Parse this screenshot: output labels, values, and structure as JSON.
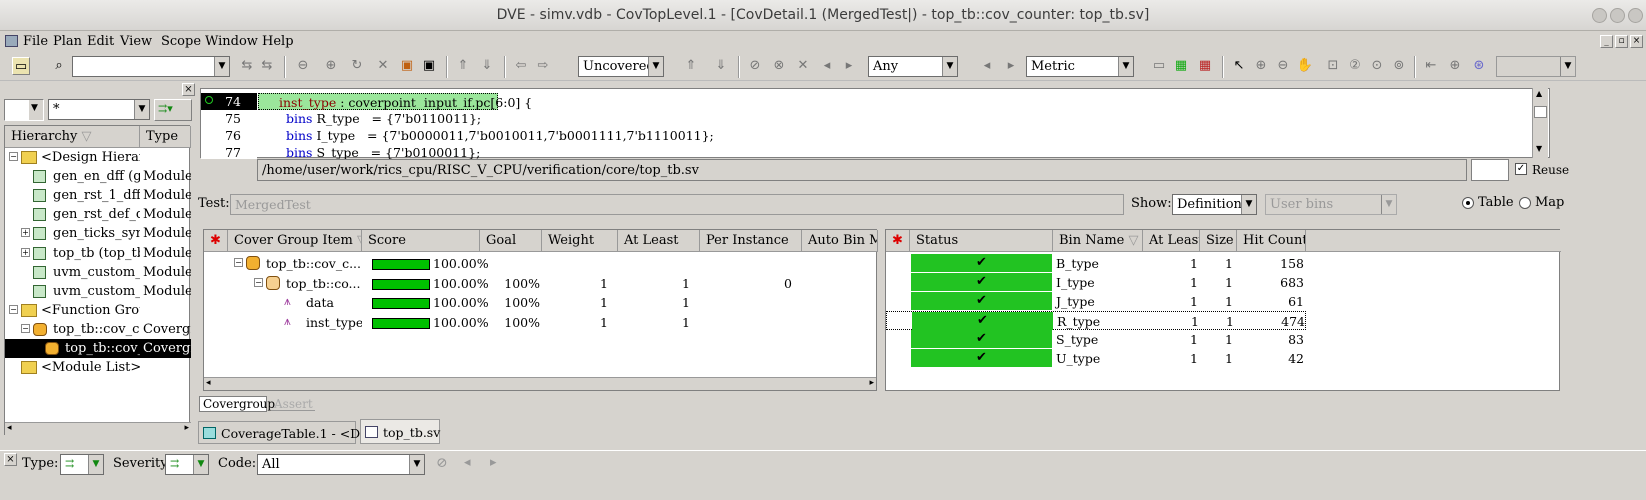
{
  "window": {
    "title": "DVE - simv.vdb - CovTopLevel.1 - [CovDetail.1 (MergedTest|) - top_tb::cov_counter: top_tb.sv]"
  },
  "menubar": {
    "items": [
      "File",
      "Plan",
      "Edit",
      "View",
      "Scope",
      "Window",
      "Help"
    ]
  },
  "toolbar": {
    "search_value": "",
    "filter_value": "Uncovered",
    "any_value": "Any",
    "metric_value": "Metric",
    "last_value": ""
  },
  "hierarchy": {
    "filter_value": "*",
    "col_hierarchy": "Hierarchy",
    "col_type": "Type",
    "rows": [
      {
        "label": "<Design Hierar...",
        "type": ""
      },
      {
        "label": "gen_en_dff (ge...",
        "type": "Module"
      },
      {
        "label": "gen_rst_1_dff ...",
        "type": "Module"
      },
      {
        "label": "gen_rst_def_df...",
        "type": "Module"
      },
      {
        "label": "gen_ticks_sync...",
        "type": "Module"
      },
      {
        "label": "top_tb (top_tb)",
        "type": "Module"
      },
      {
        "label": "uvm_custom_i...",
        "type": "Module"
      },
      {
        "label": "uvm_custom_i...",
        "type": "Module"
      },
      {
        "label": "<Function Grou...",
        "type": ""
      },
      {
        "label": "top_tb::cov_c...",
        "type": "Covergro"
      },
      {
        "label": "top_tb::cov_...",
        "type": "Covergro"
      },
      {
        "label": "<Module List>",
        "type": ""
      }
    ]
  },
  "source": {
    "lines": [
      {
        "num": "74",
        "kw": "inst_type",
        "rest": " : coverpoint  input_if.pc[6:0] {"
      },
      {
        "num": "75",
        "kw": "bins",
        "rest": " R_type   = {7'b0110011};"
      },
      {
        "num": "76",
        "kw": "bins",
        "rest": " I_type   = {7'b0000011,7'b0010011,7'b0001111,7'b1110011};"
      },
      {
        "num": "77",
        "kw": "bins",
        "rest": " S_type   = {7'b0100011};"
      }
    ],
    "path": "/home/user/work/rics_cpu/RISC_V_CPU/verification/core/top_tb.sv",
    "reuse_label": "Reuse"
  },
  "detail": {
    "test_label": "Test:",
    "test_value": "MergedTest",
    "show_label": "Show:",
    "show_value": "Definitions",
    "bins_value": "User bins",
    "table_label": "Table",
    "map_label": "Map"
  },
  "covergroup_table": {
    "headers": [
      "Cover Group Item",
      "Score",
      "Goal",
      "Weight",
      "At Least",
      "Per Instance",
      "Auto Bin Ma"
    ],
    "rows": [
      {
        "name": "top_tb::cov_c...",
        "score": "100.00%",
        "goal": "",
        "weight": "",
        "atleast": "",
        "perinst": ""
      },
      {
        "name": "top_tb::co...",
        "score": "100.00%",
        "goal": "100%",
        "weight": "1",
        "atleast": "1",
        "perinst": "0"
      },
      {
        "name": "data",
        "score": "100.00%",
        "goal": "100%",
        "weight": "1",
        "atleast": "1",
        "perinst": ""
      },
      {
        "name": "inst_type",
        "score": "100.00%",
        "goal": "100%",
        "weight": "1",
        "atleast": "1",
        "perinst": ""
      }
    ]
  },
  "bins_table": {
    "headers": [
      "Status",
      "Bin Name",
      "At Least",
      "Size",
      "Hit Count"
    ],
    "rows": [
      {
        "name": "B_type",
        "atleast": "1",
        "size": "1",
        "hits": "158"
      },
      {
        "name": "I_type",
        "atleast": "1",
        "size": "1",
        "hits": "683"
      },
      {
        "name": "J_type",
        "atleast": "1",
        "size": "1",
        "hits": "61"
      },
      {
        "name": "R_type",
        "atleast": "1",
        "size": "1",
        "hits": "474"
      },
      {
        "name": "S_type",
        "atleast": "1",
        "size": "1",
        "hits": "83"
      },
      {
        "name": "U_type",
        "atleast": "1",
        "size": "1",
        "hits": "42"
      }
    ]
  },
  "subtabs": [
    "Covergroup",
    "Assert"
  ],
  "doc_tabs": [
    "CoverageTable.1 - <D...",
    "top_tb.sv"
  ],
  "statusbar": {
    "type_label": "Type:",
    "severity_label": "Severity:",
    "code_label": "Code:",
    "code_value": "All"
  }
}
